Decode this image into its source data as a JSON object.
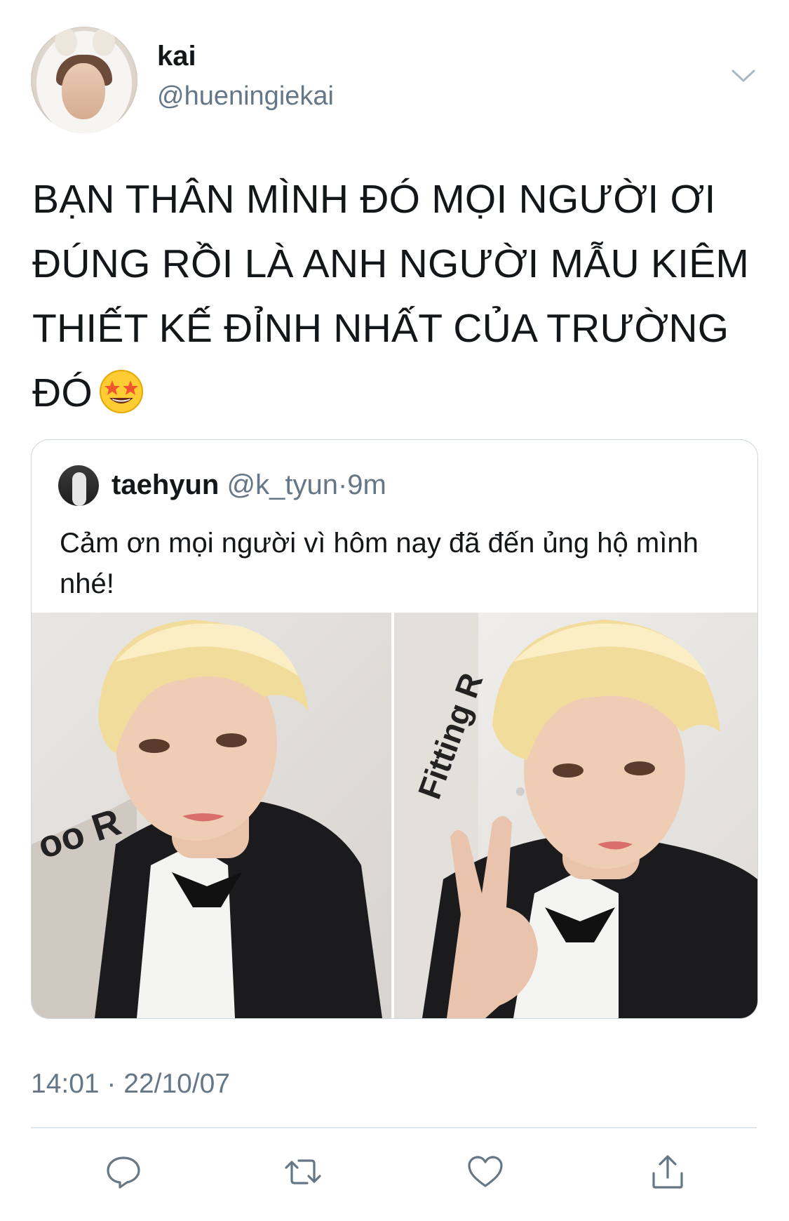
{
  "author": {
    "name": "kai",
    "handle": "@hueningiekai"
  },
  "tweet": {
    "text": "BẠN THÂN MÌNH ĐÓ MỌI NGƯỜI ƠI ĐÚNG RỒI LÀ ANH NGƯỜI MẪU KIÊM THIẾT KẾ ĐỈNH NHẤT CỦA TRƯỜNG ĐÓ",
    "emoji": "star-struck-emoji"
  },
  "quoted_tweet": {
    "name": "taehyun",
    "handle": "@k_tyun",
    "separator": "·",
    "time": "9m",
    "text": "Cảm ơn mọi người vì hôm nay đã đến ủng hộ mình nhé!",
    "photos": [
      "selfie-photo-1",
      "selfie-photo-2"
    ]
  },
  "meta": {
    "timestamp": "14:01 · 22/10/07"
  },
  "actions": [
    "reply-icon",
    "retweet-icon",
    "like-icon",
    "share-icon"
  ],
  "colors": {
    "text_primary": "#14171a",
    "text_secondary": "#657786",
    "border": "#ccd6dd",
    "icon": "#657786"
  }
}
